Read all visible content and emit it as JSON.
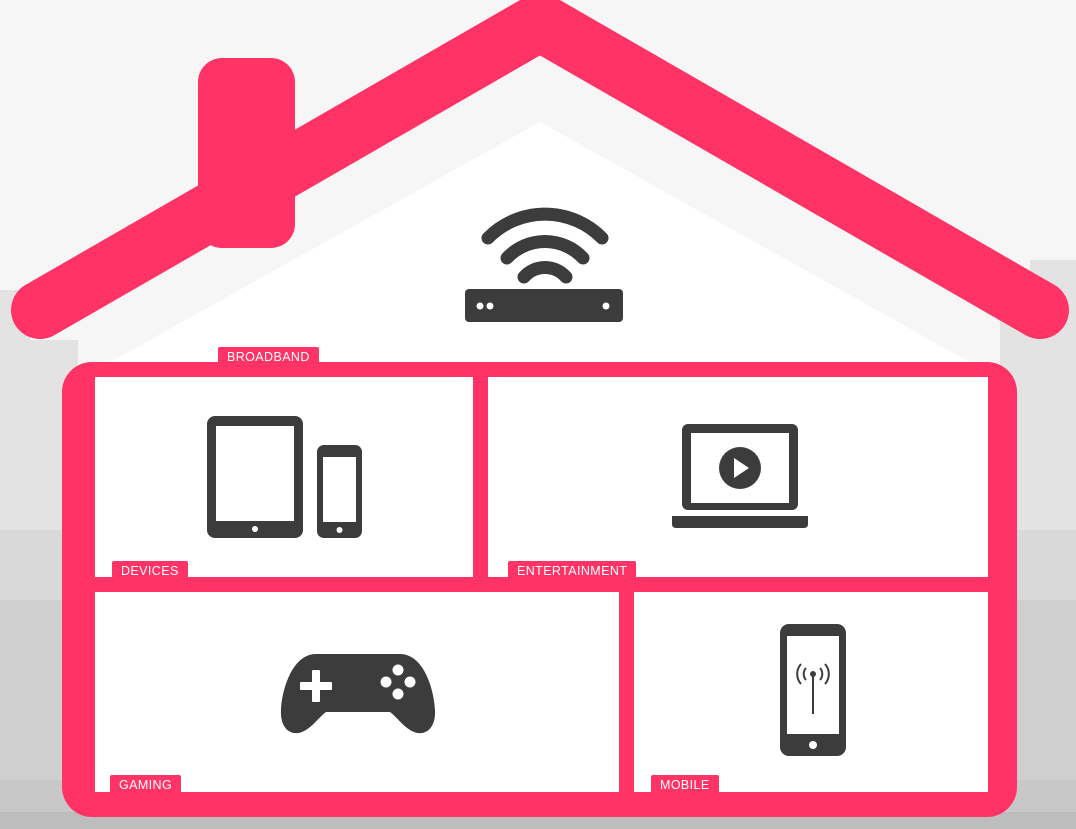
{
  "colors": {
    "accent": "#ff3366",
    "icon": "#3c3c3c",
    "room": "#ffffff",
    "skyline": "#dedede",
    "ground": "#cfcfcf"
  },
  "sections": {
    "broadband": {
      "label": "BROADBAND",
      "icon": "wifi-router-icon"
    },
    "devices": {
      "label": "DEVICES",
      "icon": "tablet-phone-icon"
    },
    "entertainment": {
      "label": "ENTERTAINMENT",
      "icon": "laptop-play-icon"
    },
    "gaming": {
      "label": "GAMING",
      "icon": "gamepad-icon"
    },
    "mobile": {
      "label": "MOBILE",
      "icon": "mobile-signal-icon"
    }
  }
}
